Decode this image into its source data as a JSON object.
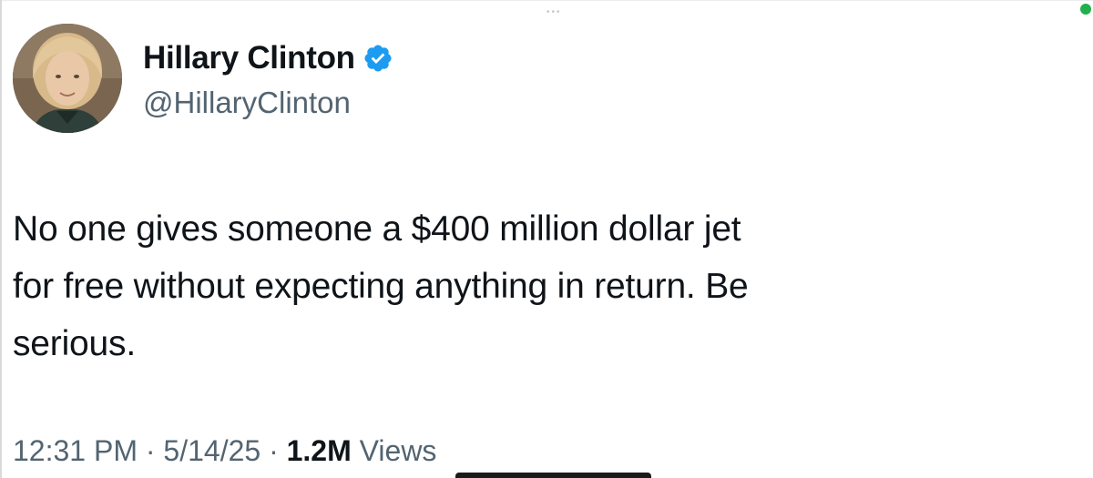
{
  "tweet": {
    "author": {
      "display_name": "Hillary Clinton",
      "handle": "@HillaryClinton",
      "verified": true,
      "avatar_icon": "profile-photo-icon"
    },
    "text_lines": [
      "No one gives someone a $400 million dollar jet",
      "for free without expecting anything in return. Be",
      "serious."
    ],
    "meta": {
      "time": "12:31 PM",
      "separator": " · ",
      "date": "5/14/25",
      "views_count": "1.2M",
      "views_label": "Views"
    }
  },
  "colors": {
    "text_primary": "#0f1419",
    "text_secondary": "#536471",
    "verified_badge": "#1d9bf0",
    "status_dot": "#22b04b"
  }
}
